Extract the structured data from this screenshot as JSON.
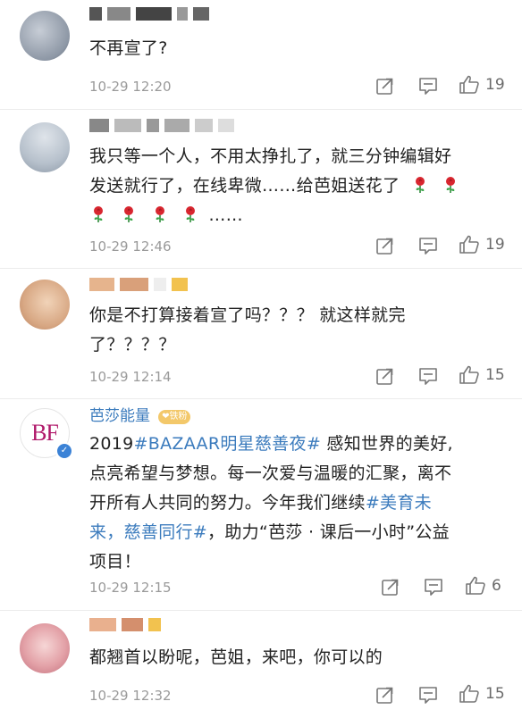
{
  "comments": [
    {
      "text_lines": [
        "不再宣了?"
      ],
      "timestamp": "10-29 12:20",
      "likes": "19"
    },
    {
      "text_lines": [
        "我只等一个人，不用太挣扎了，就三分钟编辑好",
        "发送就行了，在线卑微……给芭姐送花了",
        "……"
      ],
      "roses_line2": 2,
      "roses_line3": 4,
      "timestamp": "10-29 12:46",
      "likes": "19"
    },
    {
      "text_lines": [
        "你是不打算接着宣了吗？？？ 就这样就完",
        "了？？？？"
      ],
      "timestamp": "10-29 12:14",
      "likes": "15"
    },
    {
      "author": "芭莎能量",
      "avatar_text": "BF",
      "badge": "铁粉",
      "text_lines": [
        [
          "2019",
          "#BAZAAR明星慈善夜#",
          " 感知世界的美好,"
        ],
        [
          "点亮希望与梦想。每一次爱与温暖的汇聚，离不"
        ],
        [
          "开所有人共同的努力。今年我们继续",
          "#美育未"
        ],
        [
          "来，慈善同行#",
          "，助力“芭莎 · 课后一小时”公益"
        ],
        [
          "项目！"
        ]
      ],
      "timestamp": "10-29 12:15",
      "likes": "6"
    },
    {
      "text_lines": [
        "都翘首以盼呢，芭姐，来吧，你可以的"
      ],
      "timestamp": "10-29 12:32",
      "likes": "15"
    }
  ],
  "icons": {
    "share": "share-icon",
    "comment": "comment-icon",
    "like": "like-icon",
    "rose": "rose-icon",
    "verified": "verified-badge-icon"
  },
  "colors": {
    "link": "#3b7bbd",
    "timestamp": "#9a9a9a",
    "text": "#222222"
  }
}
